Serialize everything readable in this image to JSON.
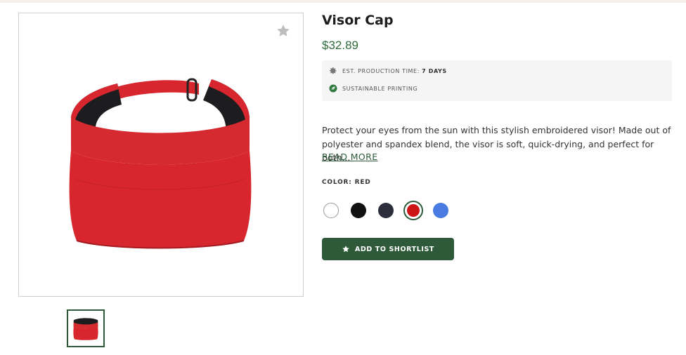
{
  "product": {
    "title": "Visor Cap",
    "price": "$32.89"
  },
  "info": {
    "production_label": "EST. PRODUCTION TIME:",
    "production_value": "7 DAYS",
    "sustainable_label": "SUSTAINABLE PRINTING"
  },
  "description": {
    "text": "Protect your eyes from the sun with this stylish embroidered visor! Made out of polyester and spandex blend, the visor is soft, quick-drying, and perfect for both...",
    "read_more": "READ MORE"
  },
  "color": {
    "label": "COLOR: RED",
    "swatches": [
      {
        "name": "white",
        "hex": "#ffffff"
      },
      {
        "name": "black",
        "hex": "#111111"
      },
      {
        "name": "navy",
        "hex": "#2c2e3c"
      },
      {
        "name": "red",
        "hex": "#cc1515",
        "selected": true
      },
      {
        "name": "royal-blue",
        "hex": "#4a7be0"
      }
    ]
  },
  "actions": {
    "shortlist_label": "ADD TO SHORTLIST"
  },
  "theme": {
    "accent": "#2f5a3a",
    "price_color": "#2f6b3a"
  }
}
